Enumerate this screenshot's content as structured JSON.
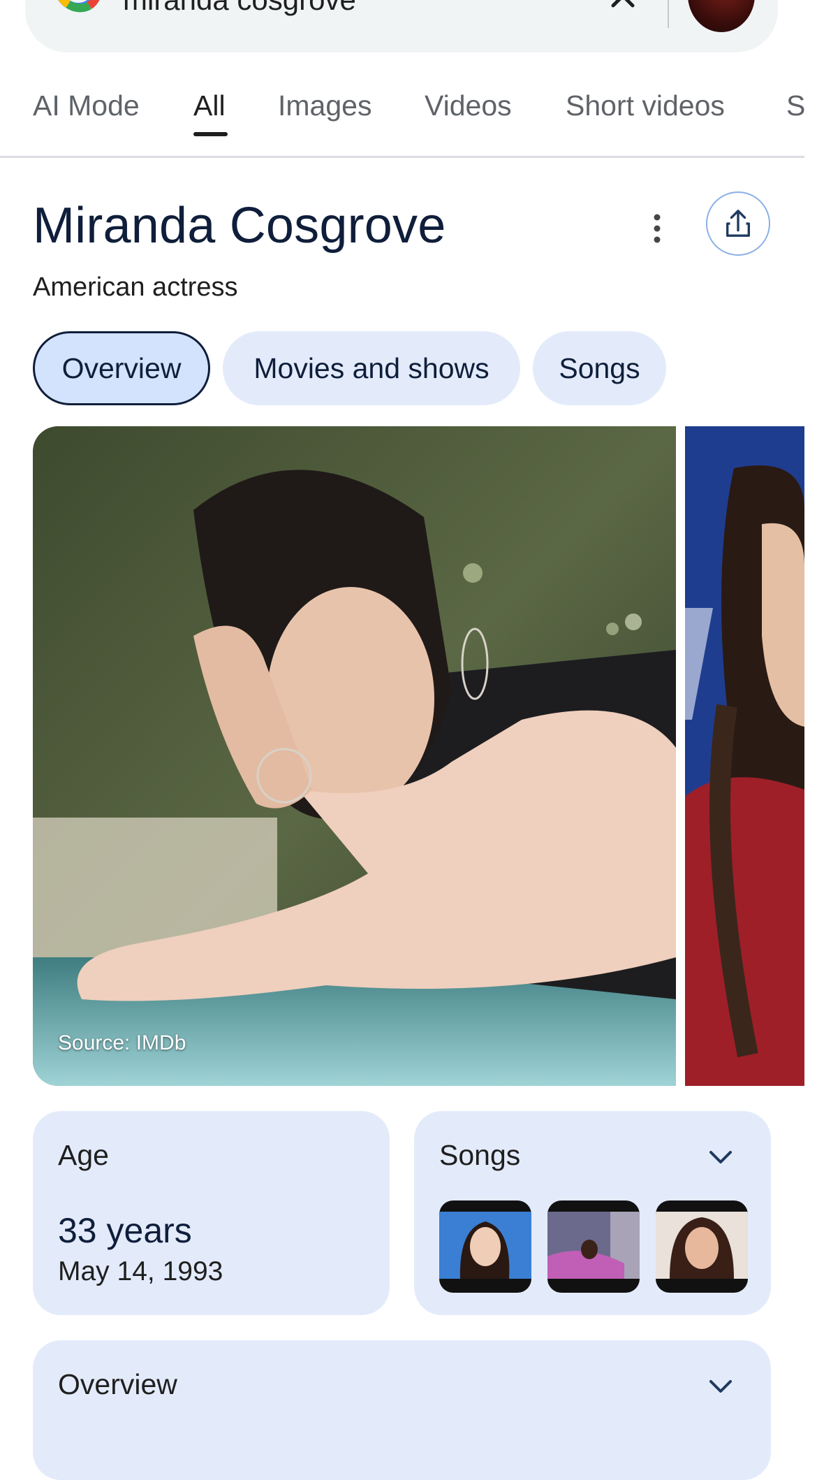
{
  "search": {
    "query": "miranda cosgrove",
    "clear_icon": "close-icon",
    "logo": "google-logo-icon"
  },
  "tabs": [
    {
      "label": "AI Mode",
      "active": false
    },
    {
      "label": "All",
      "active": true
    },
    {
      "label": "Images",
      "active": false
    },
    {
      "label": "Videos",
      "active": false
    },
    {
      "label": "Short videos",
      "active": false
    },
    {
      "label": "S",
      "active": false
    }
  ],
  "knowledge_panel": {
    "title": "Miranda Cosgrove",
    "subtitle": "American actress",
    "more_icon": "more-vert-icon",
    "share_icon": "share-icon",
    "chips": [
      {
        "label": "Overview",
        "selected": true
      },
      {
        "label": "Movies and shows",
        "selected": false
      },
      {
        "label": "Songs",
        "selected": false
      }
    ],
    "image_source": "Source: IMDb",
    "age_card": {
      "label": "Age",
      "value": "33 years",
      "birth_date": "May 14, 1993"
    },
    "songs_card": {
      "label": "Songs",
      "expand_icon": "chevron-down-icon"
    },
    "overview_card": {
      "label": "Overview",
      "expand_icon": "chevron-down-icon"
    }
  },
  "colors": {
    "accent_chip": "#d3e3fd",
    "card_bg": "#e3ebfb",
    "title": "#0f1e3a"
  }
}
